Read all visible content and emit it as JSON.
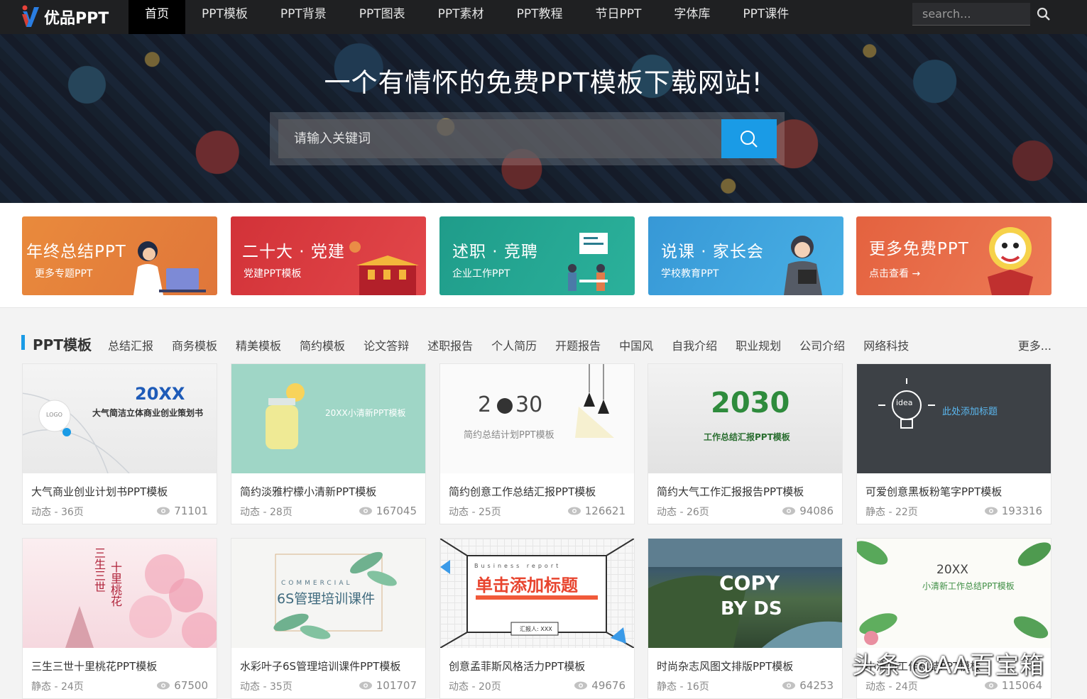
{
  "nav": {
    "logo_text": "优品PPT",
    "items": [
      "首页",
      "PPT模板",
      "PPT背景",
      "PPT图表",
      "PPT素材",
      "PPT教程",
      "节日PPT",
      "字体库",
      "PPT课件"
    ],
    "search_placeholder": "search..."
  },
  "hero": {
    "title": "一个有情怀的免费PPT模板下载网站!",
    "search_placeholder": "请输入关键词"
  },
  "banners": [
    {
      "title": "年终总结PPT",
      "subtitle": "更多专题PPT",
      "color": "#e8873a"
    },
    {
      "title": "二十大 · 党建",
      "subtitle": "党建PPT模板",
      "color": "#d9363a"
    },
    {
      "title": "述职 · 竞聘",
      "subtitle": "企业工作PPT",
      "color": "#23a38f"
    },
    {
      "title": "说课 · 家长会",
      "subtitle": "学校教育PPT",
      "color": "#3aa2d9"
    },
    {
      "title": "更多免费PPT",
      "subtitle": "点击查看 →",
      "color": "#e66a4a"
    }
  ],
  "category": {
    "title": "PPT模板",
    "links": [
      "总结汇报",
      "商务模板",
      "精美模板",
      "简约模板",
      "论文答辩",
      "述职报告",
      "个人简历",
      "开题报告",
      "中国风",
      "自我介绍",
      "职业规划",
      "公司介绍",
      "网络科技"
    ],
    "more": "更多..."
  },
  "cards": [
    {
      "title": "大气商业创业计划书PPT模板",
      "meta": "动态 - 36页",
      "views": "71101",
      "thumb_lines": [
        "20XX",
        "大气简洁立体商业创业策划书",
        "LOGO"
      ]
    },
    {
      "title": "简约淡雅柠檬小清新PPT模板",
      "meta": "动态 - 28页",
      "views": "167045",
      "thumb_lines": [
        "20XX小清新PPT模板"
      ]
    },
    {
      "title": "简约创意工作总结汇报PPT模板",
      "meta": "动态 - 25页",
      "views": "126621",
      "thumb_lines": [
        "2",
        "30",
        "简约总结计划PPT模板"
      ]
    },
    {
      "title": "简约大气工作汇报报告PPT模板",
      "meta": "动态 - 26页",
      "views": "94086",
      "thumb_lines": [
        "2030",
        "工作总结汇报PPT模板"
      ]
    },
    {
      "title": "可爱创意黑板粉笔字PPT模板",
      "meta": "静态 - 22页",
      "views": "193316",
      "thumb_lines": [
        "idea",
        "此处添加标题"
      ]
    },
    {
      "title": "三生三世十里桃花PPT模板",
      "meta": "静态 - 24页",
      "views": "67500",
      "thumb_lines": [
        "三生三世",
        "十里桃花"
      ]
    },
    {
      "title": "水彩叶子6S管理培训课件PPT模板",
      "meta": "动态 - 35页",
      "views": "101707",
      "thumb_lines": [
        "COMMERCIAL",
        "6S管理培训课件"
      ]
    },
    {
      "title": "创意孟菲斯风格活力PPT模板",
      "meta": "动态 - 20页",
      "views": "49676",
      "thumb_lines": [
        "Business report",
        "单击添加标题",
        "汇报人: XXX"
      ]
    },
    {
      "title": "时尚杂志风图文排版PPT模板",
      "meta": "静态 - 16页",
      "views": "64253",
      "thumb_lines": [
        "COPY",
        "BY DS"
      ]
    },
    {
      "title": "小清新工作总结PPT模板",
      "meta": "动态 - 24页",
      "views": "115064",
      "thumb_lines": [
        "20XX",
        "小清新工作总结PPT模板"
      ]
    }
  ],
  "watermark": "头条 @AA百宝箱",
  "colors": {
    "accent": "#1a9be6",
    "nav_bg": "#1f2022"
  }
}
